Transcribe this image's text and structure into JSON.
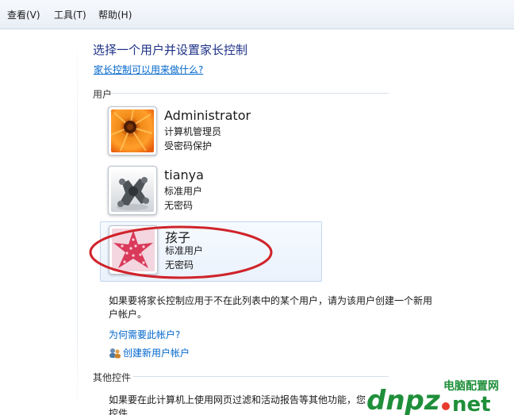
{
  "menubar": {
    "items": [
      {
        "label": "查看(V)"
      },
      {
        "label": "工具(T)"
      },
      {
        "label": "帮助(H)"
      }
    ]
  },
  "main": {
    "title": "选择一个用户并设置家长控制",
    "help_link": "家长控制可以用来做什么?",
    "users_section_label": "用户",
    "users": [
      {
        "name": "Administrator",
        "type": "计算机管理员",
        "password": "受密码保护",
        "avatar": "orange-flower"
      },
      {
        "name": "tianya",
        "type": "标准用户",
        "password": "无密码",
        "avatar": "chess-knight"
      },
      {
        "name": "孩子",
        "type": "标准用户",
        "password": "无密码",
        "avatar": "pink-starfish"
      }
    ],
    "info_text": "如果要将家长控制应用于不在此列表中的某个用户，请为该用户创建一个新用户帐户。",
    "why_link": "为何需要此帐户?",
    "create_link": "创建新用户帐户",
    "other_section_label": "其他控件",
    "other_text": "如果要在此计算机上使用网页过滤和活动报告等其他功能，您",
    "other_text_2": "控件"
  },
  "watermark": {
    "brand": "dnpz",
    "domain": ".net",
    "site_name": "电脑配置网"
  },
  "colors": {
    "link": "#0066cc",
    "title": "#1e3287",
    "annotation": "#d0232a",
    "selected_card_bg": "#eaf2fc"
  }
}
